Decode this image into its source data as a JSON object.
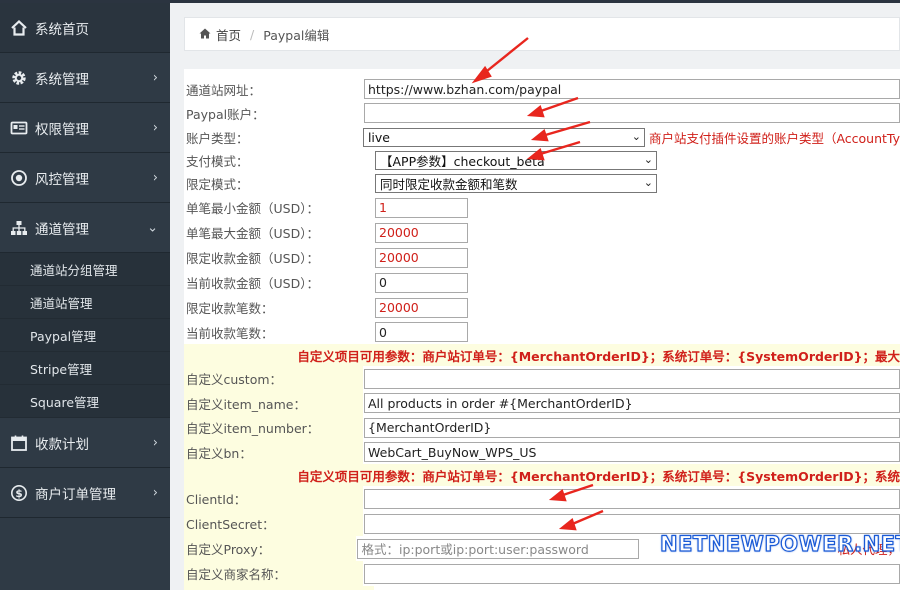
{
  "sidebar": {
    "items": [
      {
        "label": "系统首页",
        "icon": "home-icon"
      },
      {
        "label": "系统管理",
        "icon": "gear-icon"
      },
      {
        "label": "权限管理",
        "icon": "id-card-icon"
      },
      {
        "label": "风控管理",
        "icon": "dot-circle-icon"
      },
      {
        "label": "通道管理",
        "icon": "sitemap-icon"
      },
      {
        "label": "收款计划",
        "icon": "calendar-icon"
      },
      {
        "label": "商户订单管理",
        "icon": "dollar-circle-icon"
      }
    ],
    "subitems": [
      "通道站分组管理",
      "通道站管理",
      "Paypal管理",
      "Stripe管理",
      "Square管理"
    ]
  },
  "breadcrumb": {
    "home": "首页",
    "current": "Paypal编辑"
  },
  "form": {
    "site_url": {
      "label": "通道站网址：",
      "value": "https://www.bzhan.com/paypal"
    },
    "paypal_account": {
      "label": "Paypal账户：",
      "value": ""
    },
    "account_type": {
      "label": "账户类型：",
      "value": "live",
      "note": "商户站支付插件设置的账户类型（AccountTy"
    },
    "pay_mode": {
      "label": "支付模式：",
      "value": "【APP参数】checkout_beta"
    },
    "limit_mode": {
      "label": "限定模式：",
      "value": "同时限定收款金额和笔数"
    },
    "min_amount": {
      "label": "单笔最小金额（USD）：",
      "value": "1"
    },
    "max_amount": {
      "label": "单笔最大金额（USD）：",
      "value": "20000"
    },
    "limit_amount": {
      "label": "限定收款金额（USD）：",
      "value": "20000"
    },
    "current_amount": {
      "label": "当前收款金额（USD）：",
      "value": "0"
    },
    "limit_count": {
      "label": "限定收款笔数：",
      "value": "20000"
    },
    "current_count": {
      "label": "当前收款笔数：",
      "value": "0"
    },
    "custom_note_1": "自定义项目可用参数：商户站订单号：{MerchantOrderID}；系统订单号：{SystemOrderID}；最大",
    "custom": {
      "label": "自定义custom：",
      "value": ""
    },
    "item_name": {
      "label": "自定义item_name：",
      "value": "All products in order #{MerchantOrderID}"
    },
    "item_number": {
      "label": "自定义item_number：",
      "value": "{MerchantOrderID}"
    },
    "bn": {
      "label": "自定义bn：",
      "value": "WebCart_BuyNow_WPS_US"
    },
    "custom_note_2": "自定义项目可用参数：商户站订单号：{MerchantOrderID}；系统订单号：{SystemOrderID}；系统",
    "client_id": {
      "label": "ClientId：",
      "value": ""
    },
    "client_secret": {
      "label": "ClientSecret：",
      "value": ""
    },
    "proxy": {
      "label": "自定义Proxy：",
      "placeholder": "格式：ip:port或ip:port:user:password",
      "note": "私人代理，"
    },
    "merchant_name": {
      "label": "自定义商家名称：",
      "value": ""
    }
  },
  "watermark": "NETNEWPOWER.NET",
  "colors": {
    "sidebar": "#2f3a45",
    "accent_red": "#d0201a",
    "highlight_yellow": "#fdfde0",
    "arrow_red": "#e8261e",
    "watermark_blue": "#1a5ad6"
  }
}
